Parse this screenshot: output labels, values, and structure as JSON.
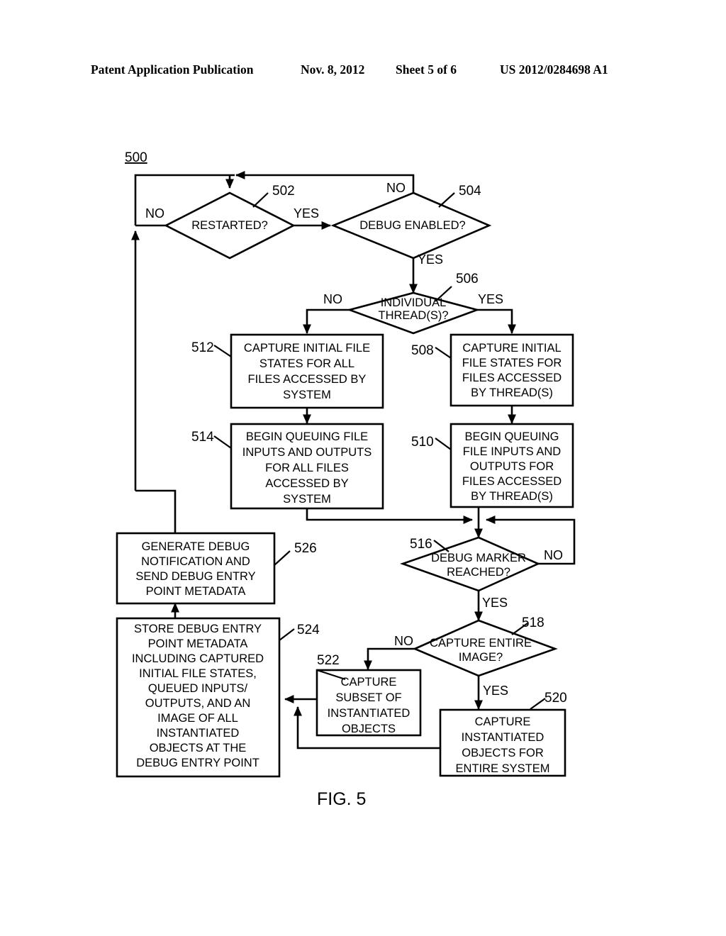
{
  "header": {
    "publication": "Patent Application Publication",
    "date": "Nov. 8, 2012",
    "sheet": "Sheet 5 of 6",
    "patent_number": "US 2012/0284698 A1"
  },
  "figure": {
    "caption": "FIG. 5",
    "diagram_number": "500",
    "type": "flowchart"
  },
  "nodes": {
    "n502": {
      "ref": "502",
      "shape": "decision",
      "lines": [
        "RESTARTED?"
      ]
    },
    "n504": {
      "ref": "504",
      "shape": "decision",
      "lines": [
        "DEBUG ENABLED?"
      ]
    },
    "n506": {
      "ref": "506",
      "shape": "decision",
      "lines": [
        "INDIVIDUAL",
        "THREAD(S)?"
      ]
    },
    "n508": {
      "ref": "508",
      "shape": "process",
      "lines": [
        "CAPTURE INITIAL",
        "FILE STATES FOR",
        "FILES ACCESSED",
        "BY THREAD(S)"
      ]
    },
    "n510": {
      "ref": "510",
      "shape": "process",
      "lines": [
        "BEGIN QUEUING",
        "FILE INPUTS AND",
        "OUTPUTS FOR",
        "FILES ACCESSED",
        "BY THREAD(S)"
      ]
    },
    "n512": {
      "ref": "512",
      "shape": "process",
      "lines": [
        "CAPTURE INITIAL FILE",
        "STATES FOR ALL",
        "FILES ACCESSED BY",
        "SYSTEM"
      ]
    },
    "n514": {
      "ref": "514",
      "shape": "process",
      "lines": [
        "BEGIN QUEUING FILE",
        "INPUTS AND OUTPUTS",
        "FOR ALL FILES",
        "ACCESSED BY",
        "SYSTEM"
      ]
    },
    "n516": {
      "ref": "516",
      "shape": "decision",
      "lines": [
        "DEBUG MARKER",
        "REACHED?"
      ]
    },
    "n518": {
      "ref": "518",
      "shape": "decision",
      "lines": [
        "CAPTURE ENTIRE",
        "IMAGE?"
      ]
    },
    "n520": {
      "ref": "520",
      "shape": "process",
      "lines": [
        "CAPTURE",
        "INSTANTIATED",
        "OBJECTS FOR",
        "ENTIRE SYSTEM"
      ]
    },
    "n522": {
      "ref": "522",
      "shape": "process",
      "lines": [
        "CAPTURE",
        "SUBSET OF",
        "INSTANTIATED",
        "OBJECTS"
      ]
    },
    "n524": {
      "ref": "524",
      "shape": "process",
      "lines": [
        "STORE DEBUG ENTRY",
        "POINT METADATA",
        "INCLUDING CAPTURED",
        "INITIAL FILE STATES,",
        "QUEUED INPUTS/",
        "OUTPUTS, AND AN",
        "IMAGE OF ALL",
        "INSTANTIATED",
        "OBJECTS AT THE",
        "DEBUG ENTRY POINT"
      ]
    },
    "n526": {
      "ref": "526",
      "shape": "process",
      "lines": [
        "GENERATE DEBUG",
        "NOTIFICATION AND",
        "SEND DEBUG ENTRY",
        "POINT METADATA"
      ]
    }
  },
  "edge_labels": {
    "e502_no": "NO",
    "e502_yes": "YES",
    "e504_no": "NO",
    "e504_yes": "YES",
    "e506_no": "NO",
    "e506_yes": "YES",
    "e516_no": "NO",
    "e516_yes": "YES",
    "e518_no": "NO",
    "e518_yes": "YES"
  },
  "colors": {
    "stroke": "#000000",
    "fill": "#ffffff",
    "text": "#000000"
  }
}
